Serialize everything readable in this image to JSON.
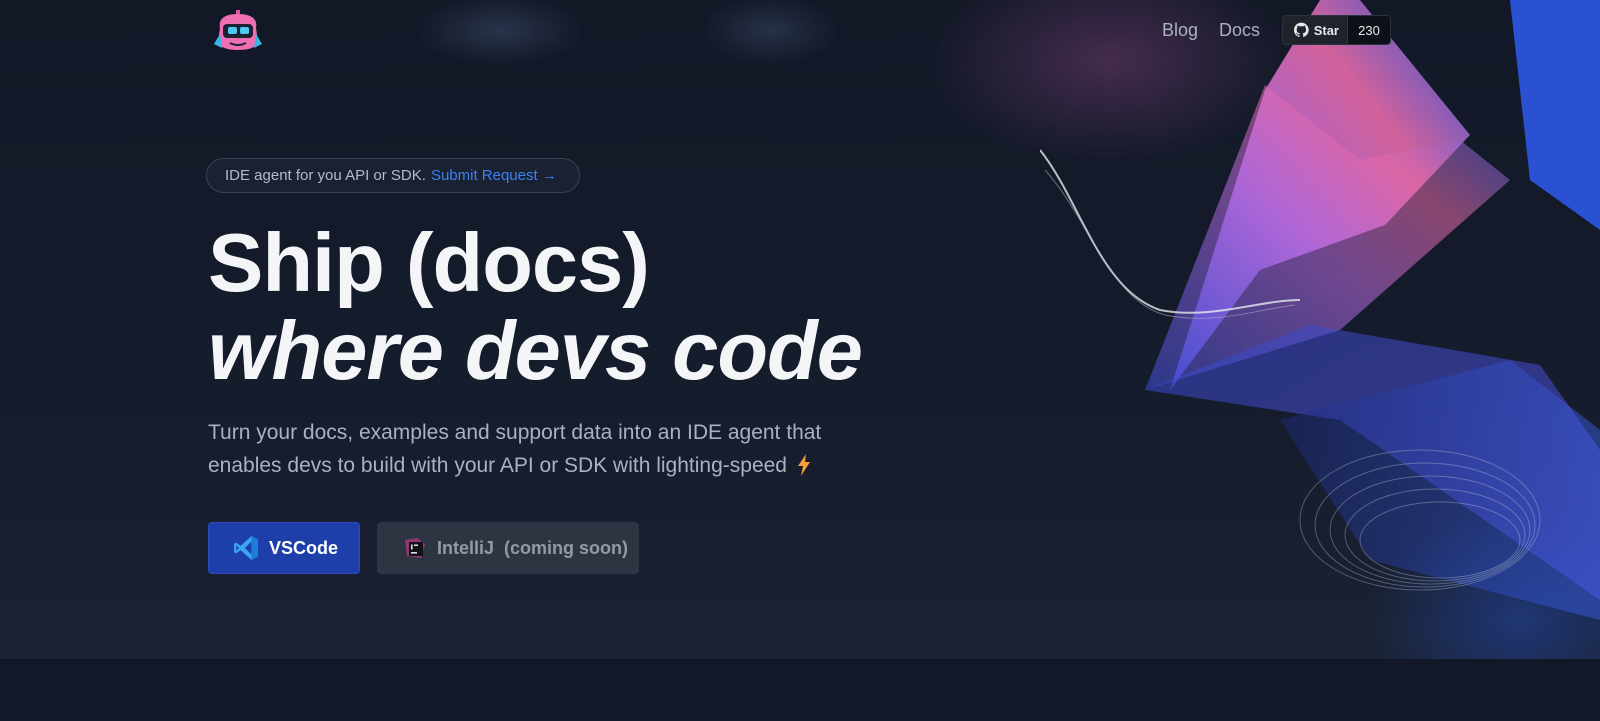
{
  "nav": {
    "logo_icon": "robot-mascot-icon",
    "links": [
      "Blog",
      "Docs"
    ],
    "github": {
      "icon": "github-icon",
      "star_label": "Star",
      "count": "230"
    }
  },
  "announcement": {
    "text": "IDE agent for you API or SDK.",
    "link_label": "Submit Request →"
  },
  "hero": {
    "title_line1": "Ship (docs)",
    "title_line2": "where devs code",
    "subtitle": "Turn your docs, examples and support data into an IDE agent that enables devs to build with your API or SDK with lighting-speed",
    "subtitle_icon": "lightning-bolt-icon"
  },
  "buttons": {
    "vscode": {
      "icon": "vscode-icon",
      "label": "VSCode"
    },
    "intellij": {
      "icon": "intellij-icon",
      "label": "IntelliJ  (coming soon)"
    }
  },
  "colors": {
    "background": "#141a29",
    "accent_link": "#3b82f6",
    "primary_button": "#1e3eaa",
    "disabled_button": "#2e3542",
    "bolt": "#f59e3b"
  }
}
